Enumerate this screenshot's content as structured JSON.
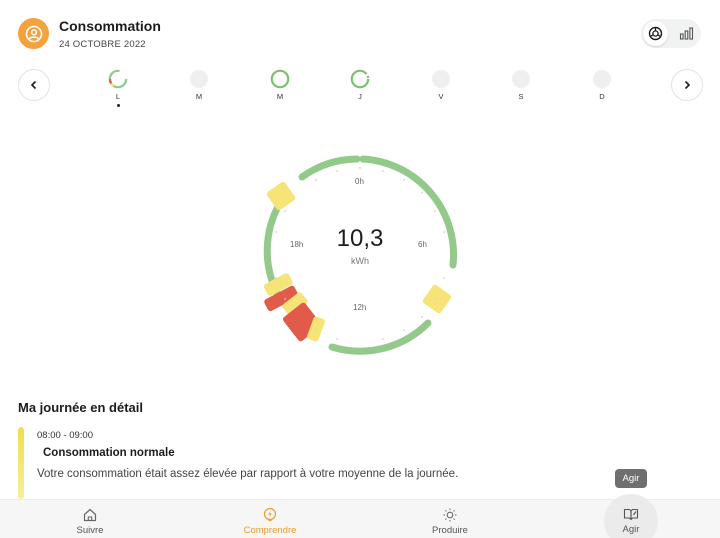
{
  "header": {
    "title": "Consommation",
    "date": "24 OCTOBRE 2022"
  },
  "colors": {
    "accent": "#f3a23e",
    "green": "#93c98a",
    "yellow": "#f7e479",
    "red": "#e25a4a"
  },
  "week": {
    "days": [
      {
        "label": "L",
        "state": "partial",
        "selected": true
      },
      {
        "label": "M",
        "state": "empty"
      },
      {
        "label": "M",
        "state": "full"
      },
      {
        "label": "J",
        "state": "full"
      },
      {
        "label": "V",
        "state": "empty"
      },
      {
        "label": "S",
        "state": "empty"
      },
      {
        "label": "D",
        "state": "empty"
      }
    ]
  },
  "dial": {
    "value": "10,3",
    "unit": "kWh",
    "hours": {
      "h0": "0h",
      "h6": "6h",
      "h12": "12h",
      "h18": "18h"
    }
  },
  "detail": {
    "title": "Ma journée en détail",
    "slot_time": "08:00 - 09:00",
    "slot_title": "Consommation normale",
    "slot_desc": "Votre consommation était assez élevée par rapport à votre moyenne de la journée."
  },
  "tooltip": "Agir",
  "bottom_nav": {
    "tabs": [
      {
        "label": "Suivre",
        "icon": "home-icon"
      },
      {
        "label": "Comprendre",
        "icon": "lightning-icon"
      },
      {
        "label": "Produire",
        "icon": "sun-icon"
      },
      {
        "label": "Agir",
        "icon": "book-icon"
      }
    ]
  }
}
